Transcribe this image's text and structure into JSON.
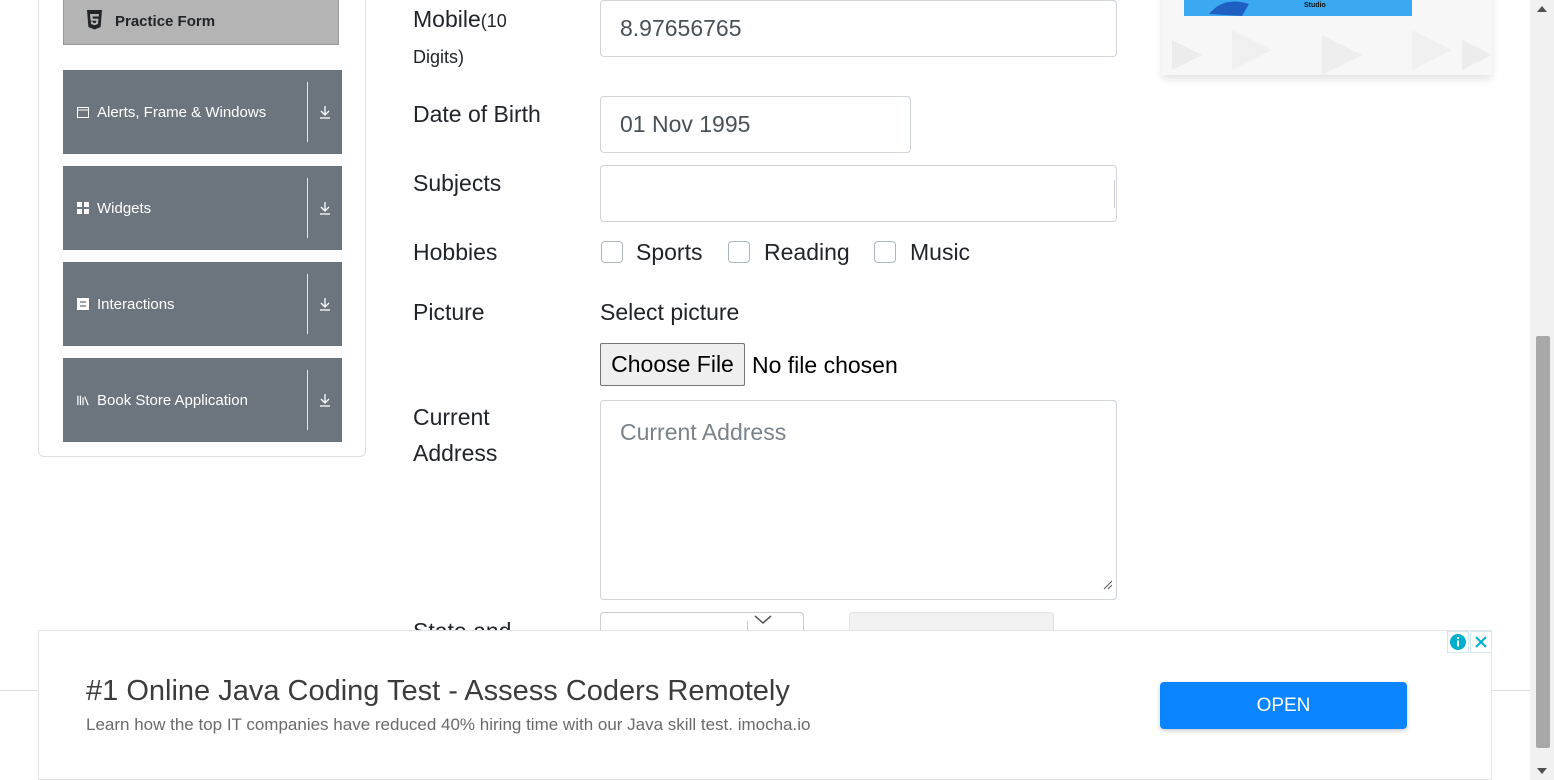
{
  "sidebar": {
    "practice_form": "Practice Form",
    "groups": [
      {
        "label": "Alerts, Frame & Windows",
        "icon": "window-icon"
      },
      {
        "label": "Widgets",
        "icon": "grid-icon"
      },
      {
        "label": "Interactions",
        "icon": "list-icon"
      },
      {
        "label": "Book Store Application",
        "icon": "books-icon"
      }
    ]
  },
  "form": {
    "mobile_label": "Mobile",
    "mobile_hint_1": "(10",
    "mobile_hint_2": "Digits)",
    "mobile_value": "8.97656765",
    "dob_label": "Date of Birth",
    "dob_value": "01 Nov 1995",
    "subjects_label": "Subjects",
    "subjects_value": "",
    "hobbies_label": "Hobbies",
    "hobbies": [
      "Sports",
      "Reading",
      "Music"
    ],
    "picture_label": "Picture",
    "select_picture": "Select picture",
    "choose_file": "Choose File",
    "no_file": "No file chosen",
    "address_label_1": "Current",
    "address_label_2": "Address",
    "address_placeholder": "Current Address",
    "state_label": "State and"
  },
  "ad": {
    "headline": "#1 Online Java Coding Test - Assess Coders Remotely",
    "description": "Learn how the top IT companies have reduced 40% hiring time with our Java skill test. imocha.io",
    "button": "OPEN",
    "brand_text": "Studio"
  },
  "colors": {
    "sidebar_group_bg": "#6c757d",
    "open_button": "#0a84ff"
  }
}
